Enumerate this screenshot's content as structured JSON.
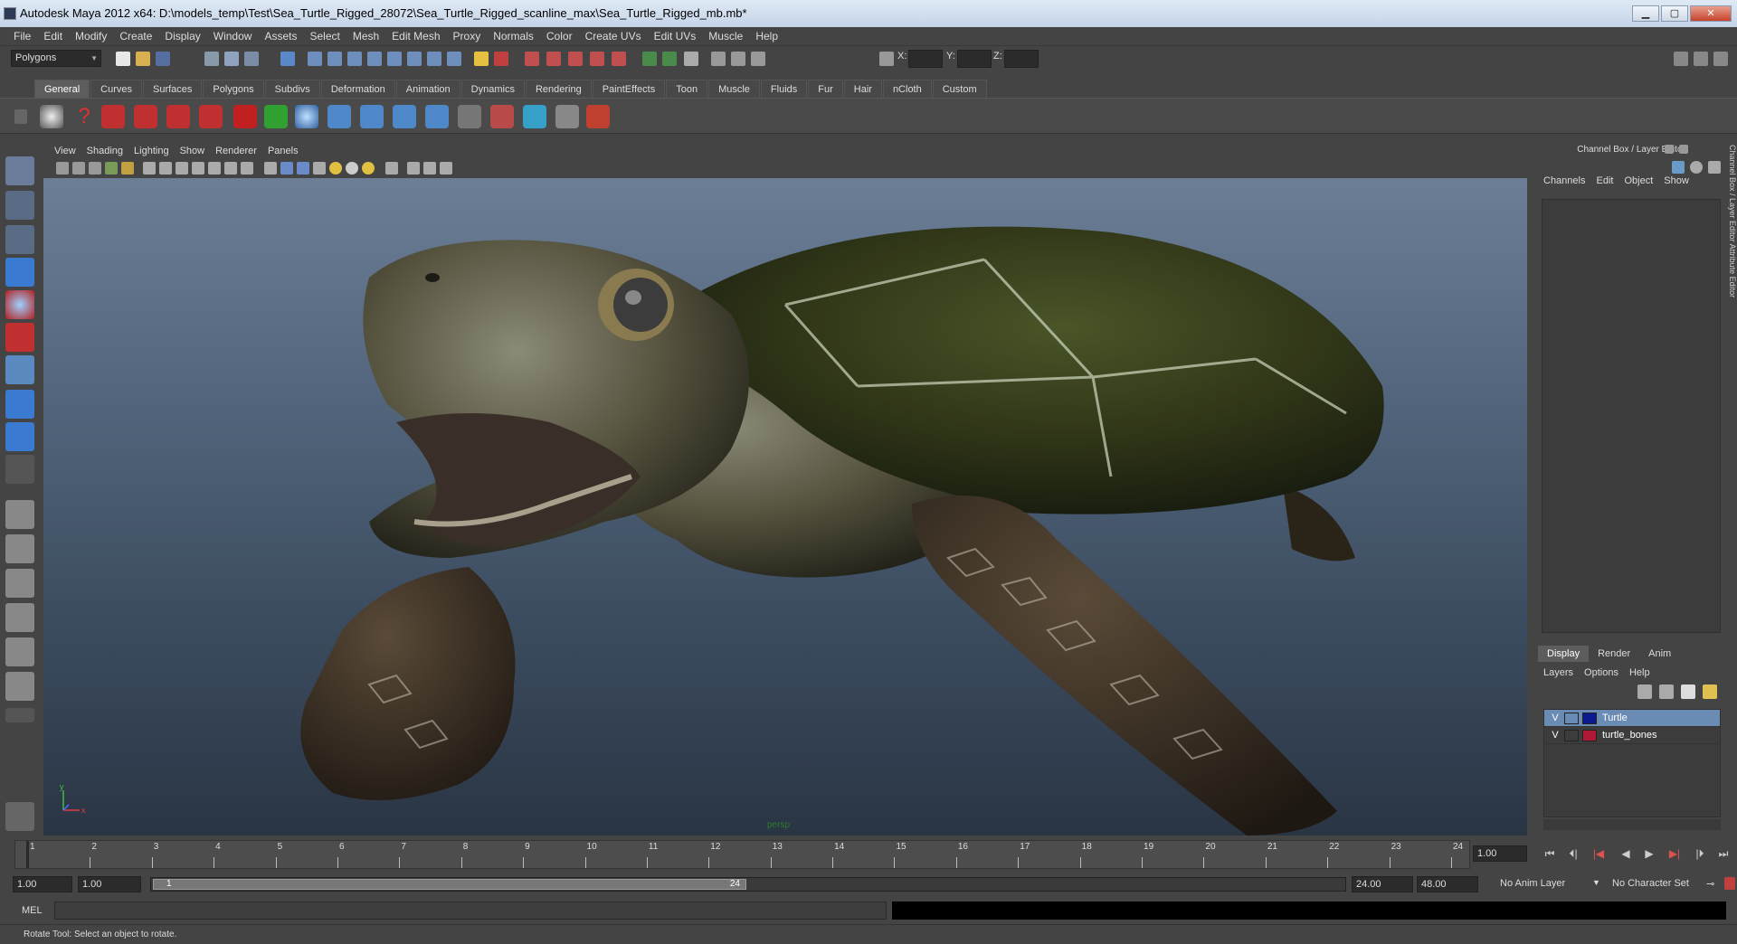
{
  "window": {
    "title": "Autodesk Maya 2012 x64: D:\\models_temp\\Test\\Sea_Turtle_Rigged_28072\\Sea_Turtle_Rigged_scanline_max\\Sea_Turtle_Rigged_mb.mb*"
  },
  "menubar": {
    "items": [
      "File",
      "Edit",
      "Modify",
      "Create",
      "Display",
      "Window",
      "Assets",
      "Select",
      "Mesh",
      "Edit Mesh",
      "Proxy",
      "Normals",
      "Color",
      "Create UVs",
      "Edit UVs",
      "Muscle",
      "Help"
    ]
  },
  "statusline": {
    "mode": "Polygons",
    "x_label": "X:",
    "y_label": "Y:",
    "z_label": "Z:"
  },
  "shelf": {
    "tabs": [
      "General",
      "Curves",
      "Surfaces",
      "Polygons",
      "Subdivs",
      "Deformation",
      "Animation",
      "Dynamics",
      "Rendering",
      "PaintEffects",
      "Toon",
      "Muscle",
      "Fluids",
      "Fur",
      "Hair",
      "nCloth",
      "Custom"
    ],
    "active": "General"
  },
  "panel": {
    "menu": [
      "View",
      "Shading",
      "Lighting",
      "Show",
      "Renderer",
      "Panels"
    ],
    "camera_label": "persp"
  },
  "channel_box": {
    "title": "Channel Box / Layer Editor",
    "menu": [
      "Channels",
      "Edit",
      "Object",
      "Show"
    ],
    "side_tabs": "Channel Box / Layer Editor    Attribute Editor"
  },
  "layer_editor": {
    "tabs": [
      "Display",
      "Render",
      "Anim"
    ],
    "active_tab": "Display",
    "menu": [
      "Layers",
      "Options",
      "Help"
    ],
    "layers": [
      {
        "visible": "V",
        "name": "Turtle",
        "color": "#0a1a8a",
        "selected": true
      },
      {
        "visible": "V",
        "name": "turtle_bones",
        "color": "#b01838",
        "selected": false
      }
    ]
  },
  "timeline": {
    "frames": [
      "1",
      "2",
      "3",
      "4",
      "5",
      "6",
      "7",
      "8",
      "9",
      "10",
      "11",
      "12",
      "13",
      "14",
      "15",
      "16",
      "17",
      "18",
      "19",
      "20",
      "21",
      "22",
      "23",
      "24"
    ],
    "current_frame": "1.00"
  },
  "range": {
    "start": "1.00",
    "playback_start": "1.00",
    "slider_start": "1",
    "slider_end": "24",
    "playback_end": "24.00",
    "end": "48.00",
    "anim_layer": "No Anim Layer",
    "character_set": "No Character Set"
  },
  "command": {
    "label": "MEL"
  },
  "help": {
    "text": "Rotate Tool: Select an object to rotate."
  }
}
